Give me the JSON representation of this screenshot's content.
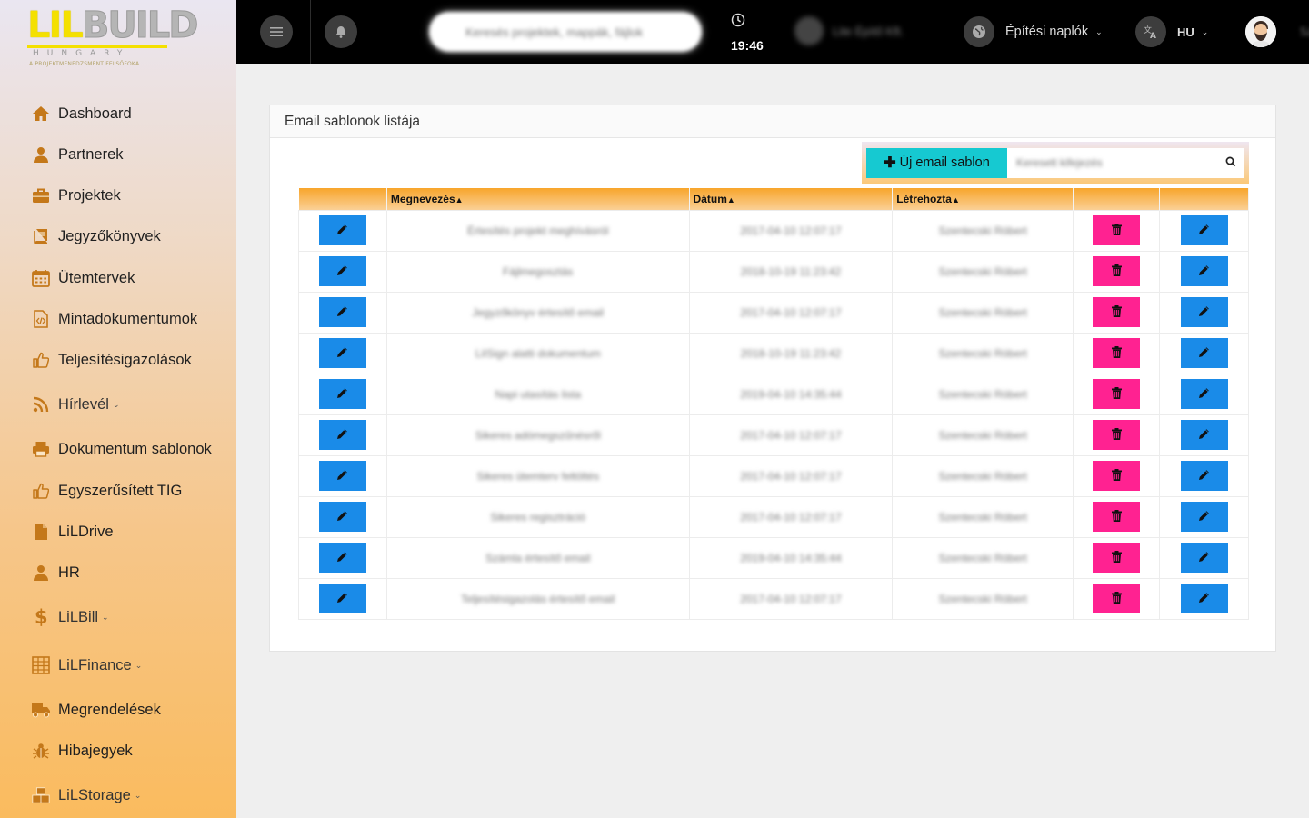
{
  "logo": {
    "lil": "LIL",
    "build": "BUILD",
    "country": "HUNGARY",
    "tagline": "A PROJEKTMENEDZSMENT FELSŐFOKA"
  },
  "sidebar": {
    "items": [
      {
        "label": "Dashboard",
        "icon": "home-icon",
        "dropdown": false
      },
      {
        "label": "Partnerek",
        "icon": "user-icon",
        "dropdown": false
      },
      {
        "label": "Projektek",
        "icon": "briefcase-icon",
        "dropdown": false
      },
      {
        "label": "Jegyzőkönyvek",
        "icon": "book-icon",
        "dropdown": false
      },
      {
        "label": "Ütemtervek",
        "icon": "calendar-icon",
        "dropdown": false
      },
      {
        "label": "Mintadokumentumok",
        "icon": "code-file-icon",
        "dropdown": false
      },
      {
        "label": "Teljesítésigazolások",
        "icon": "thumbs-up-icon",
        "dropdown": false
      },
      {
        "label": "Hírlevél",
        "icon": "rss-icon",
        "dropdown": true
      },
      {
        "label": "Dokumentum sablonok",
        "icon": "printer-icon",
        "dropdown": false
      },
      {
        "label": "Egyszerűsített TIG",
        "icon": "thumbs-up-icon",
        "dropdown": false
      },
      {
        "label": "LiLDrive",
        "icon": "file-icon",
        "dropdown": false
      },
      {
        "label": "HR",
        "icon": "user-icon",
        "dropdown": false
      },
      {
        "label": "LiLBill",
        "icon": "dollar-icon",
        "dropdown": true
      },
      {
        "label": "LiLFinance",
        "icon": "table-grid-icon",
        "dropdown": true
      },
      {
        "label": "Megrendelések",
        "icon": "truck-icon",
        "dropdown": false
      },
      {
        "label": "Hibajegyek",
        "icon": "bug-icon",
        "dropdown": false
      },
      {
        "label": "LiLStorage",
        "icon": "boxes-icon",
        "dropdown": true
      }
    ]
  },
  "topbar": {
    "search_placeholder": "Keresés projektek, mappák, fájlok",
    "time": "19:46",
    "user_name": "Lite Építő Kft.",
    "diary_label": "Építési naplók",
    "lang_label": "HU",
    "far_right": "Sze"
  },
  "card": {
    "title": "Email sablonok listája",
    "new_button_label": "Új email sablon",
    "search_placeholder": "Keresett kifejezés"
  },
  "table": {
    "headers": [
      "",
      "Megnevezés",
      "Dátum",
      "Létrehozta",
      "",
      ""
    ],
    "rows": [
      {
        "name": "Értesítés projekt meghívásról",
        "date": "2017-04-10 12:07:17",
        "creator": "Szentecski Róbert"
      },
      {
        "name": "Fájlmegosztás",
        "date": "2018-10-19 11:23:42",
        "creator": "Szentecski Róbert"
      },
      {
        "name": "Jegyzőkönyv értesítő email",
        "date": "2017-04-10 12:07:17",
        "creator": "Szentecski Róbert"
      },
      {
        "name": "LiISign alatti dokumentum",
        "date": "2018-10-19 11:23:42",
        "creator": "Szentecski Róbert"
      },
      {
        "name": "Napi utasítás lista",
        "date": "2019-04-10 14:35:44",
        "creator": "Szentecski Róbert"
      },
      {
        "name": "Sikeres adómegszűnésről",
        "date": "2017-04-10 12:07:17",
        "creator": "Szentecski Róbert"
      },
      {
        "name": "Sikeres ütemterv feltöltés",
        "date": "2017-04-10 12:07:17",
        "creator": "Szentecski Róbert"
      },
      {
        "name": "Sikeres regisztráció",
        "date": "2017-04-10 12:07:17",
        "creator": "Szentecski Róbert"
      },
      {
        "name": "Számla értesítő email",
        "date": "2019-04-10 14:35:44",
        "creator": "Szentecski Róbert"
      },
      {
        "name": "Teljesítésigazolás értesítő email",
        "date": "2017-04-10 12:07:17",
        "creator": "Szentecski Róbert"
      }
    ]
  },
  "colors": {
    "accent_orange": "#f8a52b",
    "edit_blue": "#1a8be8",
    "delete_pink": "#ff2291",
    "new_cyan": "#16c9d1"
  }
}
